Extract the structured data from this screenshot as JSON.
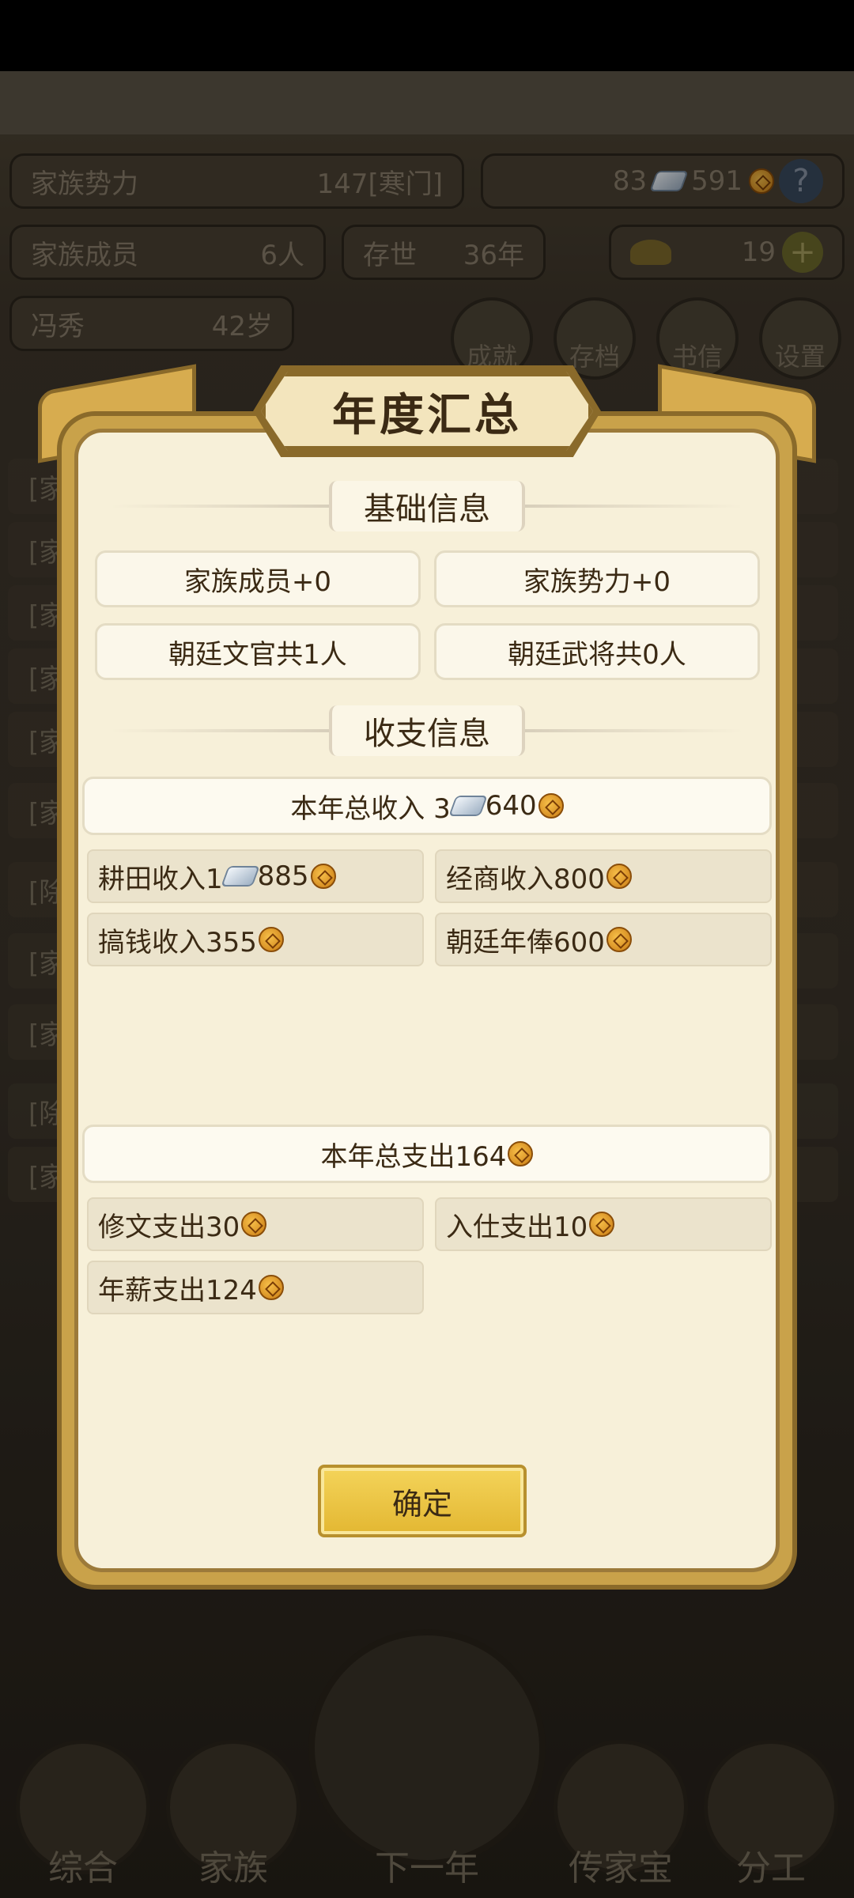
{
  "background": {
    "family_power_label": "家族势力",
    "family_power_value": "147[寒门]",
    "currency_silver": "83",
    "currency_copper": "591",
    "help_label": "?",
    "members_label": "家族成员",
    "members_value": "6人",
    "years_label": "存世",
    "years_value": "36年",
    "gold_value": "19",
    "plus_label": "+",
    "leader_name": "冯秀",
    "leader_age": "42岁",
    "round_buttons": [
      "成就",
      "存档",
      "书信",
      "设置"
    ],
    "log_prefixes": [
      "[家",
      "[家",
      "[家",
      "[家",
      "[家",
      "[家",
      "[除",
      "[家",
      "[家",
      "[除",
      "[家"
    ],
    "nav": [
      "综合",
      "家族",
      "下一年",
      "传家宝",
      "分工"
    ]
  },
  "dialog": {
    "title": "年度汇总",
    "basic_section": "基础信息",
    "basic_cards": [
      "家族成员+0",
      "家族势力+0",
      "朝廷文官共1人",
      "朝廷武将共0人"
    ],
    "finance_section": "收支信息",
    "income_total_label": "本年总收入 3",
    "income_total_amount": "640",
    "income_items": [
      {
        "label": "耕田收入1",
        "silver": true,
        "amount": "885"
      },
      {
        "label": "经商收入800",
        "silver": false,
        "amount": ""
      },
      {
        "label": "搞钱收入355",
        "silver": false,
        "amount": ""
      },
      {
        "label": "朝廷年俸600",
        "silver": false,
        "amount": ""
      }
    ],
    "expense_total_label": "本年总支出164",
    "expense_items": [
      "修文支出30",
      "入仕支出10",
      "年薪支出124"
    ],
    "confirm_label": "确定"
  },
  "colors": {
    "dialog_frame": "#c9a24a",
    "dialog_bg": "#f7f0d9",
    "text": "#3b2a14",
    "button": "#f4d45a"
  }
}
